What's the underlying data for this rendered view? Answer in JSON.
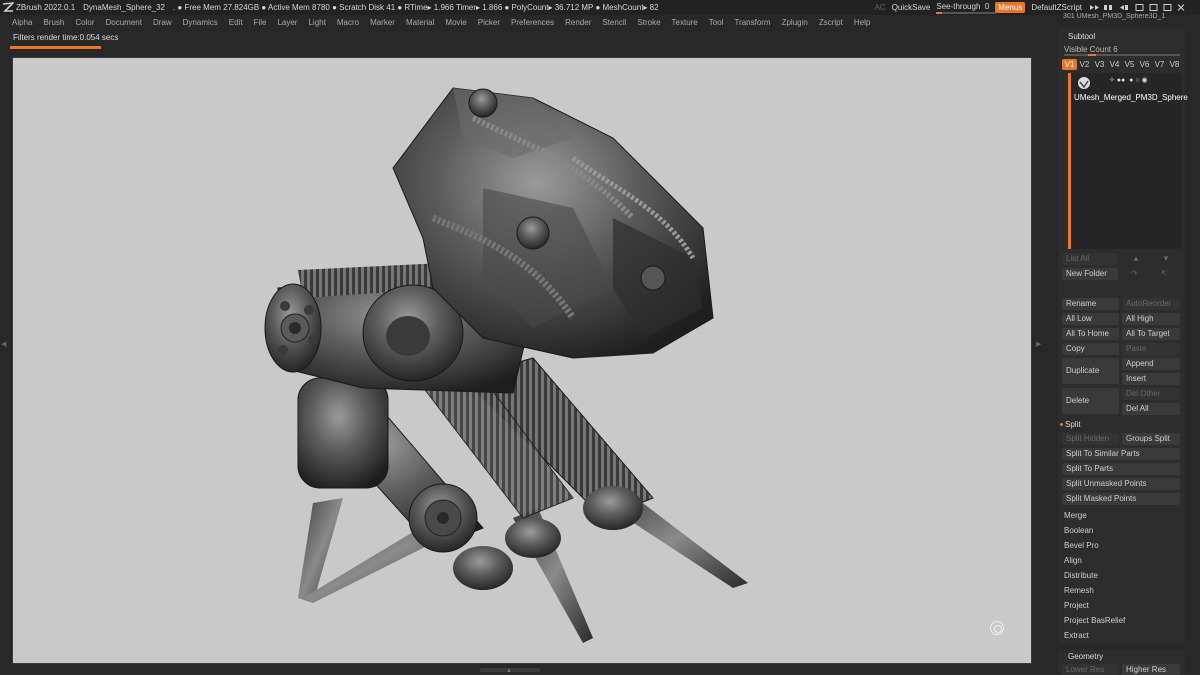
{
  "titlebar": {
    "app": "ZBrush 2022.0.1",
    "document": "DynaMesh_Sphere_32",
    "stats": ". ● Free Mem 27.824GB ● Active Mem 8780 ● Scratch Disk 41 ●  RTime▸ 1.966 Timer▸ 1.866 ● PolyCount▸ 36.712 MP  ● MeshCount▸ 82",
    "ac": "AC",
    "quicksave": "QuickSave",
    "see_through_label": "See-through",
    "see_through_value": "0",
    "menus": "Menus",
    "script": "DefaultZScript"
  },
  "menu": [
    "Alpha",
    "Brush",
    "Color",
    "Document",
    "Draw",
    "Dynamics",
    "Edit",
    "File",
    "Layer",
    "Light",
    "Macro",
    "Marker",
    "Material",
    "Movie",
    "Picker",
    "Preferences",
    "Render",
    "Stencil",
    "Stroke",
    "Texture",
    "Tool",
    "Transform",
    "Zplugin",
    "Zscript",
    "Help"
  ],
  "status": {
    "message": "Filters render time:0.054 secs"
  },
  "subtool": {
    "top_strip": "301     UMesh_PM3D_Sphere3D_1",
    "header": "Subtool",
    "visible_count": "Visible Count 6",
    "versions": [
      "V1",
      "V2",
      "V3",
      "V4",
      "V5",
      "V6",
      "V7",
      "V8"
    ],
    "active_version": "V1",
    "item_name": "UMesh_Merged_PM3D_Sphere",
    "list_all": "List All",
    "new_folder": "New Folder",
    "rename": "Rename",
    "auto_reorder": "AutoReorder",
    "all_low": "All Low",
    "all_high": "All High",
    "all_to_home": "All To Home",
    "all_to_target": "All To Target",
    "copy": "Copy",
    "paste": "Paste",
    "duplicate": "Duplicate",
    "append": "Append",
    "insert": "Insert",
    "delete": "Delete",
    "del_other": "Del Other",
    "del_all": "Del All",
    "split": "Split",
    "split_hidden": "Split Hidden",
    "groups_split": "Groups Split",
    "split_similar": "Split To Similar Parts",
    "split_parts": "Split To Parts",
    "split_unmasked": "Split Unmasked Points",
    "split_masked": "Split Masked Points",
    "merge": "Merge",
    "boolean": "Boolean",
    "bevel_pro": "Bevel Pro",
    "align": "Align",
    "distribute": "Distribute",
    "remesh": "Remesh",
    "project": "Project",
    "project_basrelief": "Project BasRelief",
    "extract": "Extract"
  },
  "geometry": {
    "header": "Geometry",
    "lower_res": "Lower Res",
    "higher_res": "Higher Res"
  },
  "colors": {
    "accent": "#e8772b",
    "canvas": "#c9c9c9",
    "panel": "#2d2d2d",
    "ui_bg": "#282828"
  }
}
